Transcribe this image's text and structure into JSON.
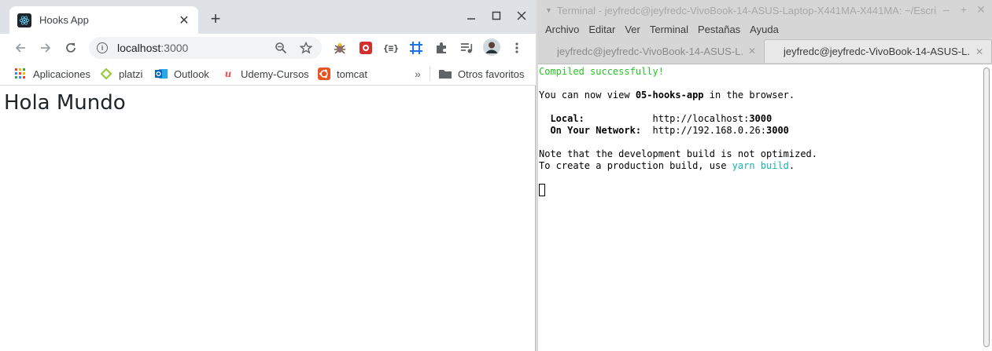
{
  "chrome": {
    "tab_title": "Hooks App",
    "tab_close": "✕",
    "new_tab": "+",
    "url_host": "localhost",
    "url_port": ":3000",
    "bookmarks": [
      {
        "label": "Aplicaciones",
        "icon": "apps-grid-icon"
      },
      {
        "label": "platzi",
        "icon": "platzi-icon"
      },
      {
        "label": "Outlook",
        "icon": "outlook-icon"
      },
      {
        "label": "Udemy-Cursos",
        "icon": "udemy-icon"
      },
      {
        "label": "tomcat",
        "icon": "ubuntu-icon"
      }
    ],
    "bookmarks_more": "»",
    "other_favorites": "Otros favoritos",
    "page_heading": "Hola Mundo",
    "colors": {
      "tabstrip": "#dee1e6",
      "react": "#61dafb"
    }
  },
  "terminal": {
    "title": "Terminal - jeyfredc@jeyfredc-VivoBook-14-ASUS-Laptop-X441MA-X441MA: ~/Escri",
    "menu": [
      "Archivo",
      "Editar",
      "Ver",
      "Terminal",
      "Pestañas",
      "Ayuda"
    ],
    "tabs": [
      {
        "label": "jeyfredc@jeyfredc-VivoBook-14-ASUS-L..."
      },
      {
        "label": "jeyfredc@jeyfredc-VivoBook-14-ASUS-L..."
      }
    ],
    "lines": {
      "compiled": "Compiled successfully!",
      "view_prefix": "You can now view ",
      "app_name": "05-hooks-app",
      "view_suffix": " in the browser.",
      "local_label": "  Local:",
      "local_pad": "            ",
      "local_url": "http://localhost:",
      "local_port": "3000",
      "network_label": "  On Your Network:",
      "network_pad": "  ",
      "network_url": "http://192.168.0.26:",
      "network_port": "3000",
      "note": "Note that the development build is not optimized.",
      "prod_prefix": "To create a production build, use ",
      "prod_cmd": "yarn build",
      "prod_suffix": "."
    },
    "colors": {
      "success": "#26c526",
      "command": "#18b2b2"
    }
  }
}
